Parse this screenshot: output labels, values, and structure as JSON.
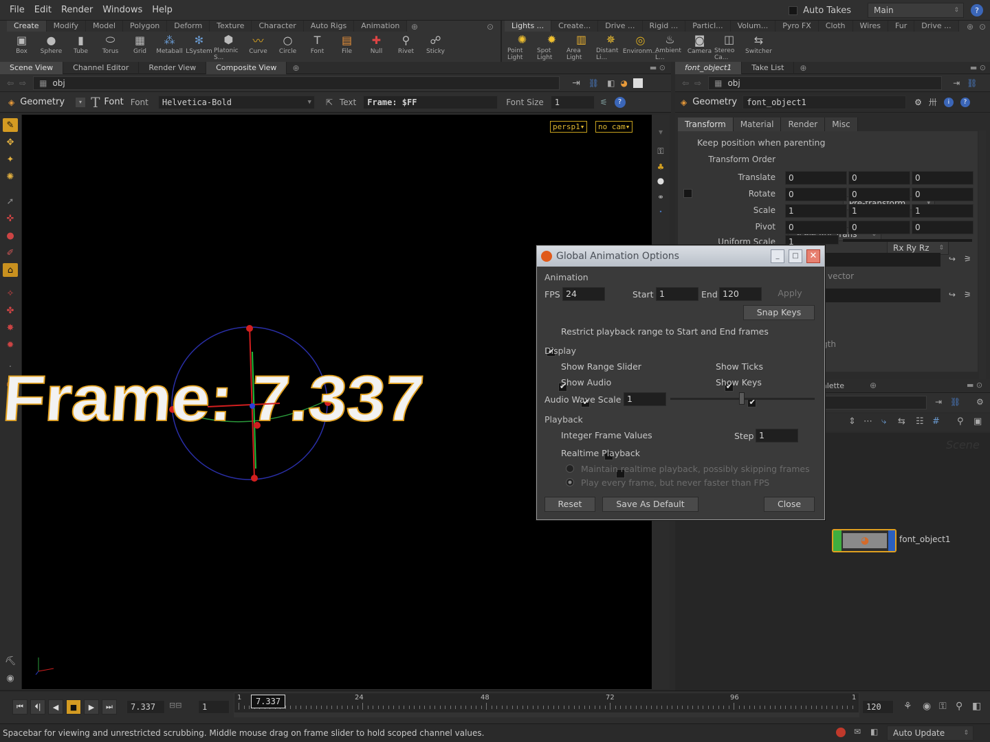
{
  "menubar": {
    "items": [
      "File",
      "Edit",
      "Render",
      "Windows",
      "Help"
    ],
    "auto_takes": "Auto Takes",
    "desktop": "Main"
  },
  "shelf_left": {
    "tabs": [
      "Create",
      "Modify",
      "Model",
      "Polygon",
      "Deform",
      "Texture",
      "Character",
      "Auto Rigs",
      "Animation"
    ],
    "tools": [
      {
        "label": "Box",
        "icon": "box-icon"
      },
      {
        "label": "Sphere",
        "icon": "sphere-icon"
      },
      {
        "label": "Tube",
        "icon": "tube-icon"
      },
      {
        "label": "Torus",
        "icon": "torus-icon"
      },
      {
        "label": "Grid",
        "icon": "grid-icon"
      },
      {
        "label": "Metaball",
        "icon": "metaball-icon"
      },
      {
        "label": "LSystem",
        "icon": "lsystem-icon"
      },
      {
        "label": "Platonic S...",
        "icon": "platonic-icon"
      },
      {
        "label": "Curve",
        "icon": "curve-icon"
      },
      {
        "label": "Circle",
        "icon": "circle-icon"
      },
      {
        "label": "Font",
        "icon": "font-icon"
      },
      {
        "label": "File",
        "icon": "file-icon"
      },
      {
        "label": "Null",
        "icon": "null-icon"
      },
      {
        "label": "Rivet",
        "icon": "rivet-icon"
      },
      {
        "label": "Sticky",
        "icon": "sticky-icon"
      }
    ]
  },
  "shelf_right": {
    "tabs": [
      "Lights ...",
      "Create...",
      "Drive ...",
      "Rigid ...",
      "Particl...",
      "Volum...",
      "Pyro FX",
      "Cloth",
      "Wires",
      "Fur",
      "Drive ..."
    ],
    "tools": [
      {
        "label": "Point Light",
        "icon": "point-light-icon"
      },
      {
        "label": "Spot Light",
        "icon": "spot-light-icon"
      },
      {
        "label": "Area Light",
        "icon": "area-light-icon"
      },
      {
        "label": "Distant Li...",
        "icon": "distant-light-icon"
      },
      {
        "label": "Environm...",
        "icon": "environment-light-icon"
      },
      {
        "label": "Ambient L...",
        "icon": "ambient-light-icon"
      },
      {
        "label": "Camera",
        "icon": "camera-icon"
      },
      {
        "label": "Stereo Ca...",
        "icon": "stereo-camera-icon"
      },
      {
        "label": "Switcher",
        "icon": "switcher-icon"
      }
    ]
  },
  "left_pane": {
    "tabs": [
      "Scene View",
      "Channel Editor",
      "Render View",
      "Composite View"
    ],
    "path": "obj",
    "toolbar": {
      "context": "Geometry",
      "node_type": "Font",
      "font_label": "Font",
      "font_value": "Helvetica-Bold",
      "text_label": "Text",
      "text_value": "Frame: $FF",
      "fontsize_label": "Font Size",
      "fontsize_value": "1"
    },
    "viewport": {
      "camera": "persp1",
      "cam": "no cam",
      "frame_text": "Frame: 7.337"
    }
  },
  "right_pane": {
    "tabs": [
      "font_object1",
      "Take List"
    ],
    "path": "obj",
    "context": "Geometry",
    "node_name": "font_object1",
    "parm_tabs": [
      "Transform",
      "Material",
      "Render",
      "Misc"
    ],
    "keep_pos_label": "Keep position when parenting",
    "pretransform": "Pre-transform",
    "transform_order_label": "Transform Order",
    "transform_order": "Scale Rot Trans",
    "rot_order": "Rx Ry Rz",
    "parms": [
      {
        "label": "Translate",
        "v": [
          "0",
          "0",
          "0"
        ]
      },
      {
        "label": "Rotate",
        "v": [
          "0",
          "0",
          "0"
        ]
      },
      {
        "label": "Scale",
        "v": [
          "1",
          "1",
          "1"
        ]
      },
      {
        "label": "Pivot",
        "v": [
          "0",
          "0",
          "0"
        ]
      }
    ],
    "uniform_scale_label": "Uniform Scale",
    "uniform_scale": "1",
    "vector_frag": "vector",
    "length_frag": "gth",
    "network_tab": "alette",
    "scene_watermark": "Scene",
    "node": "font_object1"
  },
  "dialog": {
    "title": "Global Animation Options",
    "animation_section": "Animation",
    "fps_label": "FPS",
    "fps": "24",
    "start_label": "Start",
    "start": "1",
    "end_label": "End",
    "end": "120",
    "apply": "Apply",
    "snap_keys": "Snap Keys",
    "restrict": "Restrict playback range to Start and End frames",
    "display_section": "Display",
    "show_range_slider": "Show Range Slider",
    "show_ticks": "Show Ticks",
    "show_audio": "Show Audio",
    "show_keys": "Show Keys",
    "audio_wave_label": "Audio Wave Scale",
    "audio_wave": "1",
    "playback_section": "Playback",
    "integer_frames": "Integer Frame Values",
    "step_label": "Step",
    "step": "1",
    "realtime": "Realtime Playback",
    "maintain": "Maintain realtime playback, possibly skipping frames",
    "every_frame": "Play every frame, but never faster than FPS",
    "reset": "Reset",
    "save_default": "Save As Default",
    "close": "Close"
  },
  "timeline": {
    "current": "7.337",
    "step": "1",
    "range_start": "1",
    "range_end": "120",
    "ticks": [
      "24",
      "48",
      "72",
      "96"
    ],
    "marker": "7.337",
    "end_label": "1"
  },
  "status": {
    "message": "Spacebar for viewing and unrestricted scrubbing. Middle mouse drag on frame slider to hold scoped channel values.",
    "auto_update": "Auto Update"
  },
  "colors": {
    "accent": "#e8a21a",
    "viewport_bg": "#000000",
    "dialog_title": "#c7cdd5"
  }
}
